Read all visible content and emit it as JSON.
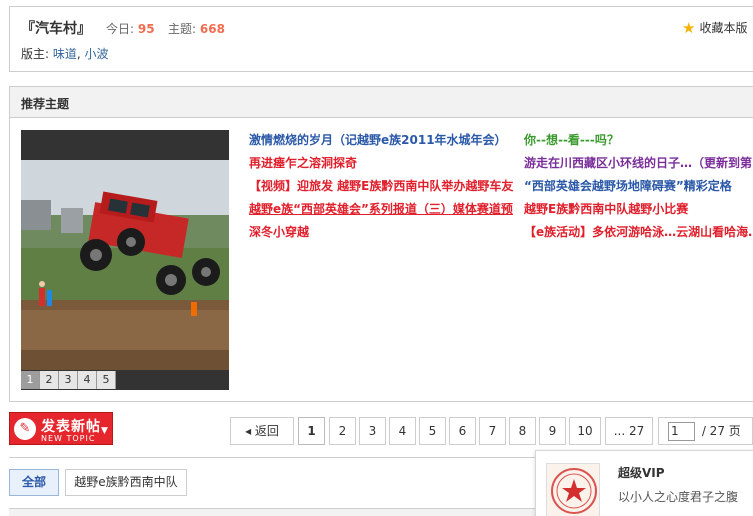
{
  "forum": {
    "title": "『汽车村』",
    "today_label": "今日:",
    "today_count": "95",
    "topics_label": "主题:",
    "topics_count": "668",
    "moderators_label": "版主:",
    "moderators": [
      "味道",
      "小波"
    ],
    "moderators_sep": ",",
    "favorite_label": "收藏本版"
  },
  "recommend": {
    "title": "推荐主题",
    "slide_numbers": [
      "1",
      "2",
      "3",
      "4",
      "5"
    ],
    "left_column": [
      {
        "text": "激情燃烧的岁月（记越野e族2011年水城年会）",
        "color": "#2b59a8"
      },
      {
        "text": "再进瘗乍之溶洞探奇",
        "color": "#e0202c"
      },
      {
        "text": "【视频】迎旅发 越野E族黔西南中队举办越野车友",
        "color": "#e0202c"
      },
      {
        "text": "越野e族“西部英雄会”系列报道（三）媒体赛道预",
        "color": "#e0202c"
      },
      {
        "text": "深冬小穿越",
        "color": "#e0202c"
      }
    ],
    "right_column": [
      {
        "text": "你--想--看---吗？",
        "color": "#3c9b2f"
      },
      {
        "text": "游走在川西藏区小环线的日子…（更新到第",
        "color": "#7a2e9a"
      },
      {
        "text": "“西部英雄会越野场地障碍赛”精彩定格",
        "color": "#2b59a8"
      },
      {
        "text": "越野E族黔西南中队越野小比赛",
        "color": "#e0202c"
      },
      {
        "text": "【e族活动】多依河游哈泳…云湖山看哈海…",
        "color": "#e0202c"
      }
    ]
  },
  "post_button": {
    "label": "发表新帖",
    "sublabel": "NEW TOPIC",
    "pen_icon": "✎",
    "arrow": "▼"
  },
  "pager": {
    "back": "返回",
    "back_icon": "◂",
    "pages": [
      "1",
      "2",
      "3",
      "4",
      "5",
      "6",
      "7",
      "8",
      "9",
      "10",
      "... 27"
    ],
    "current_page": "1",
    "input_value": "1",
    "total": "/ 27 页"
  },
  "filter": {
    "all_label": "全部",
    "tag_label": "越野e族黔西南中队"
  },
  "user_card": {
    "level": "超级VIP",
    "signature": "以小人之心度君子之腹"
  },
  "colors": {
    "accent_red": "#e5272d",
    "link_blue": "#2b59a8",
    "count_orange": "#f26c4f",
    "star_yellow": "#f5b400"
  }
}
